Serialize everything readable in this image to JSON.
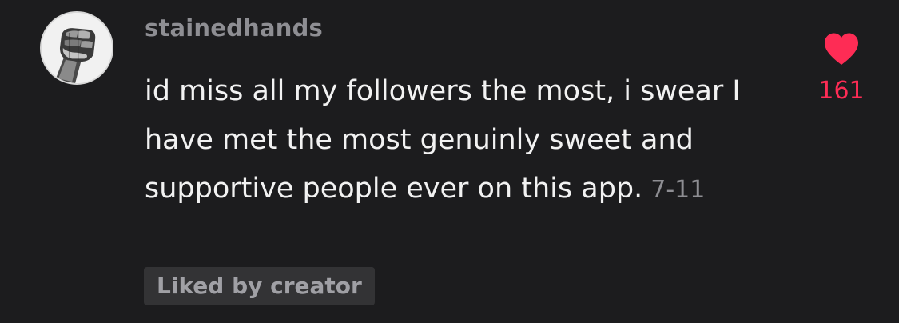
{
  "comment": {
    "username": "stainedhands",
    "text": "id miss all my followers the most, i swear I have met the most genuinly sweet and supportive people ever on this app.",
    "timestamp": "7-11",
    "badge": "Liked by creator",
    "avatar_icon": "raised-fist-icon",
    "like_icon": "heart-icon",
    "like_count": "161",
    "colors": {
      "background": "#1c1c1e",
      "username": "#8e8e93",
      "text": "#f2f2f2",
      "like": "#fe2c55",
      "badge_bg": "#333335"
    }
  }
}
